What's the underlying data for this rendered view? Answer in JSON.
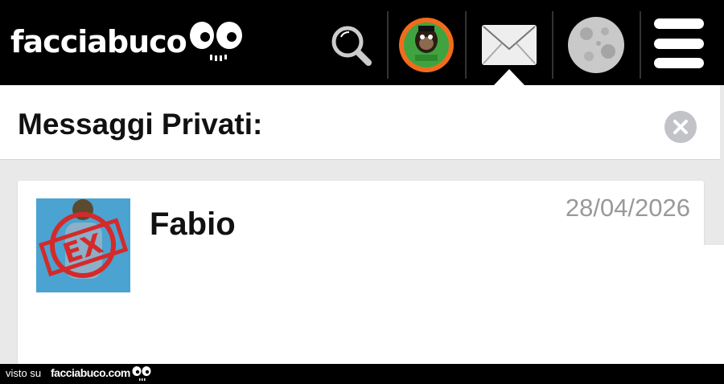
{
  "header": {
    "logo_text": "facciabuco",
    "icons": [
      "search-icon",
      "profile-avatar",
      "envelope-icon",
      "moon-icon",
      "hamburger-menu-icon"
    ]
  },
  "panel": {
    "title": "Messaggi Privati:",
    "close_icon": "close-icon"
  },
  "messages": [
    {
      "sender": "Fabio",
      "date": "28/04/2026",
      "avatar_text": "EX"
    }
  ],
  "footer": {
    "visto_label": "visto su",
    "site_label": "facciabuco.com"
  },
  "colors": {
    "topbar": "#000000",
    "panel_bg": "#ffffff",
    "page_bg": "#e9e9e9",
    "date_text": "#999999",
    "close_bg": "#c1c3c7",
    "avatar_ring": "#f26b1d",
    "avatar_stamp": "#d42a2a"
  }
}
